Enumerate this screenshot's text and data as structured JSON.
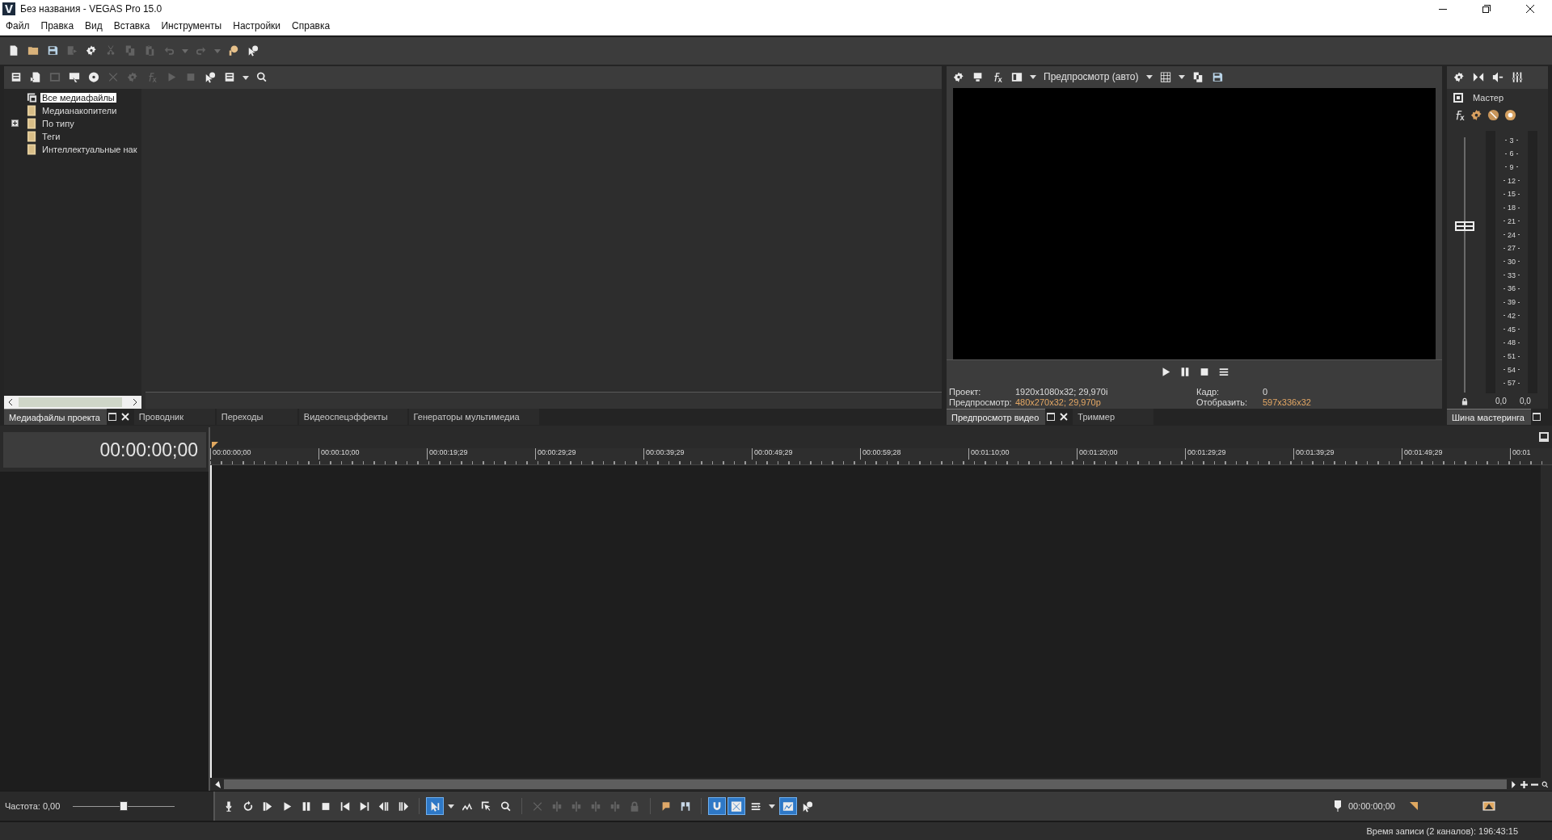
{
  "window": {
    "title": "Без названия - VEGAS Pro 15.0"
  },
  "menu": [
    "Файл",
    "Правка",
    "Вид",
    "Вставка",
    "Инструменты",
    "Настройки",
    "Справка"
  ],
  "main_toolbar": [
    {
      "kind": "new",
      "disabled": false
    },
    {
      "kind": "open",
      "disabled": false
    },
    {
      "kind": "save",
      "disabled": false
    },
    {
      "kind": "render",
      "disabled": true
    },
    {
      "kind": "gear",
      "disabled": false
    },
    {
      "kind": "cut",
      "disabled": true
    },
    {
      "kind": "copy",
      "disabled": true
    },
    {
      "kind": "paste",
      "disabled": true
    },
    {
      "kind": "undo",
      "disabled": true
    },
    {
      "kind": "caret",
      "disabled": true
    },
    {
      "kind": "redo",
      "disabled": true
    },
    {
      "kind": "caret",
      "disabled": true
    },
    {
      "kind": "hand-help",
      "disabled": false
    },
    {
      "kind": "cursor-help",
      "disabled": false
    }
  ],
  "media_toolbar": [
    {
      "kind": "import",
      "disabled": false
    },
    {
      "kind": "capture",
      "disabled": false
    },
    {
      "kind": "picture-off",
      "disabled": true
    },
    {
      "kind": "get-media",
      "disabled": false
    },
    {
      "kind": "disc",
      "disabled": false
    },
    {
      "kind": "delete",
      "disabled": true
    },
    {
      "kind": "gear",
      "disabled": true
    },
    {
      "kind": "fx",
      "disabled": true
    },
    {
      "kind": "play",
      "disabled": true
    },
    {
      "kind": "stop",
      "disabled": true
    },
    {
      "kind": "autopreview",
      "disabled": false
    },
    {
      "kind": "views",
      "disabled": false
    },
    {
      "kind": "caret",
      "disabled": false
    },
    {
      "kind": "search",
      "disabled": false
    }
  ],
  "media_tree": [
    {
      "label": "Все медиафайлы",
      "kind": "all",
      "expandable": false,
      "selected": true
    },
    {
      "label": "Медианакопители",
      "kind": "folder",
      "expandable": false,
      "selected": false
    },
    {
      "label": "По типу",
      "kind": "folder",
      "expandable": true,
      "selected": false
    },
    {
      "label": "Теги",
      "kind": "folder",
      "expandable": false,
      "selected": false
    },
    {
      "label": "Интеллектуальные нак",
      "kind": "folder",
      "expandable": false,
      "selected": false
    }
  ],
  "media_tabs": [
    {
      "label": "Медиафайлы проекта",
      "selected": true
    },
    {
      "label": "Проводник",
      "selected": false
    },
    {
      "label": "Переходы",
      "selected": false
    },
    {
      "label": "Видеоспецэффекты",
      "selected": false
    },
    {
      "label": "Генераторы мультимедиа",
      "selected": false
    }
  ],
  "preview_toolbar": [
    {
      "kind": "gear",
      "disabled": false
    },
    {
      "kind": "copy-preview",
      "disabled": false
    },
    {
      "kind": "fx",
      "disabled": false
    },
    {
      "kind": "split",
      "disabled": false
    },
    {
      "kind": "caret",
      "disabled": false
    }
  ],
  "preview_mode": "Предпросмотр (авто)",
  "preview_toolbar_2": [
    {
      "kind": "grid",
      "disabled": false
    },
    {
      "kind": "caret",
      "disabled": false
    },
    {
      "kind": "copy",
      "disabled": false
    },
    {
      "kind": "save",
      "disabled": false
    }
  ],
  "preview_controls": [
    {
      "kind": "play",
      "disabled": false
    },
    {
      "kind": "pause",
      "disabled": false
    },
    {
      "kind": "stop",
      "disabled": false
    },
    {
      "kind": "lines",
      "disabled": false
    }
  ],
  "preview_info": [
    {
      "label": "Проект:",
      "value": "1920x1080x32; 29,970i",
      "highlight": false
    },
    {
      "label": "Предпросмотр:",
      "value": "480x270x32; 29,970p",
      "highlight": true
    },
    {
      "label": "Кадр:",
      "value": "0",
      "highlight": false
    },
    {
      "label": "Отобразить:",
      "value": "597x336x32",
      "highlight": true
    }
  ],
  "preview_tabs": [
    {
      "label": "Предпросмотр видео",
      "selected": true
    },
    {
      "label": "Триммер",
      "selected": false
    }
  ],
  "master_toolbar": [
    {
      "kind": "gear",
      "disabled": false
    },
    {
      "kind": "bowtie",
      "disabled": false
    },
    {
      "kind": "speaker",
      "disabled": false
    },
    {
      "kind": "mixer",
      "disabled": false
    }
  ],
  "master": {
    "name": "Мастер",
    "fader": {
      "level": 0.65
    },
    "scale": [
      "3",
      "6",
      "9",
      "12",
      "15",
      "18",
      "21",
      "24",
      "27",
      "30",
      "33",
      "36",
      "39",
      "42",
      "45",
      "48",
      "51",
      "54",
      "57"
    ],
    "readings": [
      "0,0",
      "0,0"
    ],
    "tab": "Шина мастеринга"
  },
  "timeline": {
    "time": "00:00:00;00",
    "ruler": [
      "00:00:00;00",
      "00:00:10;00",
      "00:00:19;29",
      "00:00:29;29",
      "00:00:39;29",
      "00:00:49;29",
      "00:00:59;28",
      "00:01:10;00",
      "00:01:20;00",
      "00:01:29;29",
      "00:01:39;29",
      "00:01:49;29",
      "00:01"
    ]
  },
  "rate": {
    "label": "Частота: 0,00",
    "level": 0.5
  },
  "transport": [
    {
      "kind": "mic",
      "disabled": false,
      "active": false
    },
    {
      "kind": "loop",
      "disabled": false,
      "active": false
    },
    {
      "kind": "play-start",
      "disabled": false,
      "active": false
    },
    {
      "kind": "play",
      "disabled": false,
      "active": false
    },
    {
      "kind": "pause",
      "disabled": false,
      "active": false
    },
    {
      "kind": "stop",
      "disabled": false,
      "active": false
    },
    {
      "kind": "prev",
      "disabled": false,
      "active": false
    },
    {
      "kind": "next",
      "disabled": false,
      "active": false
    },
    {
      "kind": "frame-back",
      "disabled": false,
      "active": false
    },
    {
      "kind": "frame-fwd",
      "disabled": false,
      "active": false
    },
    {
      "kind": "sep"
    },
    {
      "kind": "cursor",
      "disabled": false,
      "active": true
    },
    {
      "kind": "caret",
      "disabled": false,
      "active": false
    },
    {
      "kind": "envelope",
      "disabled": false,
      "active": false
    },
    {
      "kind": "selection",
      "disabled": false,
      "active": false
    },
    {
      "kind": "search",
      "disabled": false,
      "active": false
    },
    {
      "kind": "sep"
    },
    {
      "kind": "delete",
      "disabled": true,
      "active": false
    },
    {
      "kind": "trim",
      "disabled": true,
      "active": false
    },
    {
      "kind": "trim",
      "disabled": true,
      "active": false
    },
    {
      "kind": "trim",
      "disabled": true,
      "active": false
    },
    {
      "kind": "trim",
      "disabled": true,
      "active": false
    },
    {
      "kind": "lock",
      "disabled": true,
      "active": false
    },
    {
      "kind": "sep"
    },
    {
      "kind": "marker",
      "disabled": false,
      "active": false
    },
    {
      "kind": "region",
      "disabled": false,
      "active": false
    },
    {
      "kind": "sep"
    },
    {
      "kind": "magnet",
      "disabled": false,
      "active": true
    },
    {
      "kind": "crossfade",
      "disabled": false,
      "active": true
    },
    {
      "kind": "ripple",
      "disabled": false,
      "active": false
    },
    {
      "kind": "caret",
      "disabled": false,
      "active": false
    },
    {
      "kind": "lock-env",
      "disabled": false,
      "active": true
    },
    {
      "kind": "cursor-help",
      "disabled": false,
      "active": false
    }
  ],
  "transport_time": "00:00:00;00",
  "status_bar": "Время записи (2 каналов): 196:43:15"
}
